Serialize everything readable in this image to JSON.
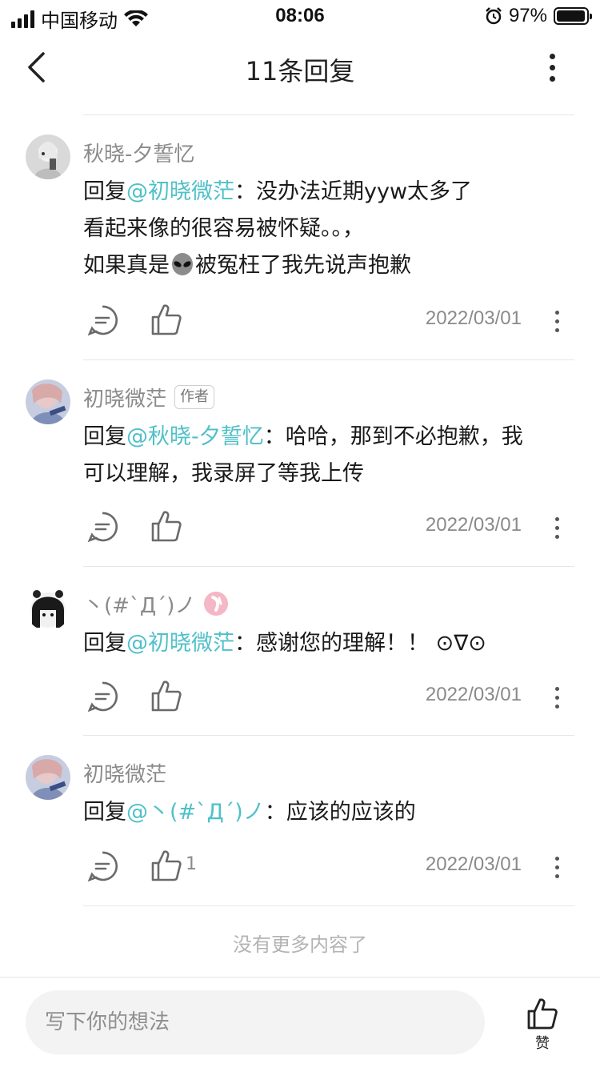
{
  "status_bar": {
    "carrier": "中国移动",
    "time": "08:06",
    "battery": "97%",
    "battery_level": 0.97
  },
  "nav": {
    "title": "11条回复"
  },
  "comments": [
    {
      "username": "秋晓-夕誓忆",
      "reply_prefix": "回复",
      "mention": "@初晓微茫",
      "sep": "：",
      "line1_text": "没办法近期yyw太多了",
      "line2_text": "看起来像的很容易被怀疑。。，",
      "line3_before": "如果真是",
      "line3_after": "被冤枉了我先说声抱歉",
      "date": "2022/03/01"
    },
    {
      "username": "初晓微茫",
      "badge": "作者",
      "reply_prefix": "回复",
      "mention": "@秋晓-夕誓忆",
      "sep": "：",
      "line1_text": "哈哈，那到不必抱歉，我",
      "line2_text": "可以理解，我录屏了等我上传",
      "date": "2022/03/01"
    },
    {
      "username": "丶(#`Д´)ノ",
      "reply_prefix": "回复",
      "mention": "@初晓微茫",
      "sep": "：",
      "line1_text": "感谢您的理解！！ ⊙∇⊙",
      "date": "2022/03/01"
    },
    {
      "username": "初晓微茫",
      "reply_prefix": "回复",
      "mention": "@丶(#`Д´)ノ",
      "sep": "：",
      "line1_text": "应该的应该的",
      "like_count": "1",
      "date": "2022/03/01"
    }
  ],
  "footer": {
    "no_more": "没有更多内容了"
  },
  "bottom_bar": {
    "input_placeholder": "写下你的想法",
    "like_label": "赞"
  },
  "colors": {
    "mention": "#4fc0c8",
    "secondary_text": "#8a8a8a"
  },
  "icons": [
    "signal-icon",
    "wifi-icon",
    "alarm-icon",
    "battery-icon",
    "back-arrow-icon",
    "more-icon",
    "reply-icon",
    "thumbs-up-icon",
    "alien-emoji",
    "pink-badge-icon"
  ]
}
